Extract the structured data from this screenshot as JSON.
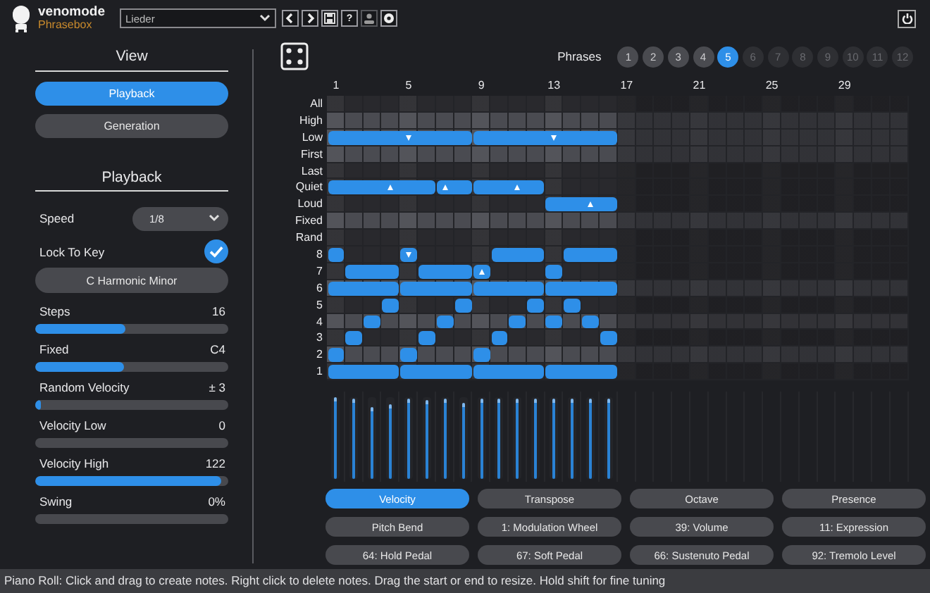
{
  "header": {
    "brand": "venomode",
    "product": "Phrasebox",
    "preset": "Lieder",
    "tools": [
      {
        "kind": "prev",
        "disabled": false
      },
      {
        "kind": "next",
        "disabled": false
      },
      {
        "kind": "save",
        "disabled": false
      },
      {
        "kind": "help",
        "label": "?",
        "disabled": false
      },
      {
        "kind": "user",
        "disabled": true
      },
      {
        "kind": "settings",
        "disabled": false
      }
    ]
  },
  "view": {
    "title": "View",
    "tabs": [
      {
        "label": "Playback",
        "selected": true
      },
      {
        "label": "Generation",
        "selected": false
      }
    ]
  },
  "playback": {
    "title": "Playback",
    "speed": {
      "label": "Speed",
      "value": "1/8"
    },
    "lock": {
      "label": "Lock To Key",
      "checked": true
    },
    "scale": "C Harmonic Minor",
    "sliders": [
      {
        "label": "Steps",
        "value": "16",
        "level": 0.47
      },
      {
        "label": "Fixed",
        "value": "C4",
        "level": 0.46
      },
      {
        "label": "Random Velocity",
        "value": "± 3",
        "level": 0.03
      },
      {
        "label": "Velocity Low",
        "value": "0",
        "level": 0
      },
      {
        "label": "Velocity High",
        "value": "122",
        "level": 0.96
      },
      {
        "label": "Swing",
        "value": "0%",
        "level": 0
      }
    ]
  },
  "phrases": {
    "label": "Phrases",
    "items": [
      {
        "label": "1",
        "selected": false,
        "filled": true
      },
      {
        "label": "2",
        "selected": false,
        "filled": true
      },
      {
        "label": "3",
        "selected": false,
        "filled": true
      },
      {
        "label": "4",
        "selected": false,
        "filled": true
      },
      {
        "label": "5",
        "selected": true,
        "filled": true
      },
      {
        "label": "6",
        "selected": false,
        "filled": false
      },
      {
        "label": "7",
        "selected": false,
        "filled": false
      },
      {
        "label": "8",
        "selected": false,
        "filled": false
      },
      {
        "label": "9",
        "selected": false,
        "filled": false
      },
      {
        "label": "10",
        "selected": false,
        "filled": false
      },
      {
        "label": "11",
        "selected": false,
        "filled": false
      },
      {
        "label": "12",
        "selected": false,
        "filled": false
      }
    ]
  },
  "grid": {
    "columns": [
      "1",
      "5",
      "9",
      "13",
      "17",
      "21",
      "25",
      "29"
    ],
    "rows": [
      {
        "label": "All",
        "shaded": false,
        "steps": [
          {
            "kind": "rest"
          },
          {
            "kind": "rest"
          },
          {
            "kind": "rest"
          },
          {
            "kind": "rest"
          },
          {
            "kind": "rest"
          },
          {
            "kind": "rest"
          },
          {
            "kind": "rest"
          },
          {
            "kind": "rest"
          },
          {
            "kind": "rest"
          },
          {
            "kind": "rest"
          },
          {
            "kind": "rest"
          },
          {
            "kind": "rest"
          },
          {
            "kind": "rest"
          },
          {
            "kind": "rest"
          },
          {
            "kind": "rest"
          },
          {
            "kind": "rest"
          }
        ]
      },
      {
        "label": "High",
        "shaded": true,
        "steps": [
          {
            "kind": "rest"
          },
          {
            "kind": "rest"
          },
          {
            "kind": "rest"
          },
          {
            "kind": "rest"
          },
          {
            "kind": "rest"
          },
          {
            "kind": "rest"
          },
          {
            "kind": "rest"
          },
          {
            "kind": "rest"
          },
          {
            "kind": "rest"
          },
          {
            "kind": "rest"
          },
          {
            "kind": "rest"
          },
          {
            "kind": "rest"
          },
          {
            "kind": "rest"
          },
          {
            "kind": "rest"
          },
          {
            "kind": "rest"
          },
          {
            "kind": "rest"
          }
        ]
      },
      {
        "label": "Low",
        "shaded": true,
        "steps": [
          {
            "kind": "note"
          },
          {
            "kind": "note",
            "tied": true
          },
          {
            "kind": "note",
            "tied": true
          },
          {
            "kind": "note",
            "tied": true
          },
          {
            "kind": "note-down",
            "tied": true
          },
          {
            "kind": "note",
            "tied": true
          },
          {
            "kind": "note",
            "tied": true
          },
          {
            "kind": "note",
            "tied": true
          },
          {
            "kind": "note",
            "tied": false
          },
          {
            "kind": "note",
            "tied": true
          },
          {
            "kind": "note",
            "tied": true
          },
          {
            "kind": "note",
            "tied": true
          },
          {
            "kind": "note-down",
            "tied": true
          },
          {
            "kind": "note",
            "tied": true
          },
          {
            "kind": "note",
            "tied": true
          },
          {
            "kind": "note",
            "tied": true
          }
        ]
      },
      {
        "label": "First",
        "shaded": true,
        "steps": [
          {
            "kind": "rest"
          },
          {
            "kind": "rest"
          },
          {
            "kind": "rest"
          },
          {
            "kind": "rest"
          },
          {
            "kind": "rest"
          },
          {
            "kind": "rest"
          },
          {
            "kind": "rest"
          },
          {
            "kind": "rest"
          },
          {
            "kind": "rest"
          },
          {
            "kind": "rest"
          },
          {
            "kind": "rest"
          },
          {
            "kind": "rest"
          },
          {
            "kind": "rest"
          },
          {
            "kind": "rest"
          },
          {
            "kind": "rest"
          },
          {
            "kind": "rest"
          }
        ]
      },
      {
        "label": "Last",
        "shaded": false,
        "steps": [
          {
            "kind": "rest"
          },
          {
            "kind": "rest"
          },
          {
            "kind": "rest"
          },
          {
            "kind": "rest"
          },
          {
            "kind": "rest"
          },
          {
            "kind": "rest"
          },
          {
            "kind": "rest"
          },
          {
            "kind": "rest"
          },
          {
            "kind": "rest"
          },
          {
            "kind": "rest"
          },
          {
            "kind": "rest"
          },
          {
            "kind": "rest"
          },
          {
            "kind": "rest"
          },
          {
            "kind": "rest"
          },
          {
            "kind": "rest"
          },
          {
            "kind": "rest"
          }
        ]
      },
      {
        "label": "Quiet",
        "shaded": false,
        "steps": [
          {
            "kind": "note"
          },
          {
            "kind": "note",
            "tied": true
          },
          {
            "kind": "note",
            "tied": true
          },
          {
            "kind": "note-up",
            "tied": true
          },
          {
            "kind": "note",
            "tied": true
          },
          {
            "kind": "note",
            "tied": true
          },
          {
            "kind": "note-up",
            "tied": false
          },
          {
            "kind": "note",
            "tied": true
          },
          {
            "kind": "note",
            "tied": false
          },
          {
            "kind": "note",
            "tied": true
          },
          {
            "kind": "note-up",
            "tied": true
          },
          {
            "kind": "note",
            "tied": true
          },
          {
            "kind": "rest"
          },
          {
            "kind": "rest"
          },
          {
            "kind": "rest"
          },
          {
            "kind": "rest"
          }
        ]
      },
      {
        "label": "Loud",
        "shaded": false,
        "steps": [
          {
            "kind": "rest"
          },
          {
            "kind": "rest"
          },
          {
            "kind": "rest"
          },
          {
            "kind": "rest"
          },
          {
            "kind": "rest"
          },
          {
            "kind": "rest"
          },
          {
            "kind": "rest"
          },
          {
            "kind": "rest"
          },
          {
            "kind": "rest"
          },
          {
            "kind": "rest"
          },
          {
            "kind": "rest"
          },
          {
            "kind": "rest"
          },
          {
            "kind": "note"
          },
          {
            "kind": "note",
            "tied": true
          },
          {
            "kind": "note-up",
            "tied": true
          },
          {
            "kind": "note",
            "tied": true
          }
        ]
      },
      {
        "label": "Fixed",
        "shaded": true,
        "steps": [
          {
            "kind": "rest"
          },
          {
            "kind": "rest"
          },
          {
            "kind": "rest"
          },
          {
            "kind": "rest"
          },
          {
            "kind": "rest"
          },
          {
            "kind": "rest"
          },
          {
            "kind": "rest"
          },
          {
            "kind": "rest"
          },
          {
            "kind": "rest"
          },
          {
            "kind": "rest"
          },
          {
            "kind": "rest"
          },
          {
            "kind": "rest"
          },
          {
            "kind": "rest"
          },
          {
            "kind": "rest"
          },
          {
            "kind": "rest"
          },
          {
            "kind": "rest"
          }
        ]
      },
      {
        "label": "Rand",
        "shaded": false,
        "steps": [
          {
            "kind": "rest"
          },
          {
            "kind": "rest"
          },
          {
            "kind": "rest"
          },
          {
            "kind": "rest"
          },
          {
            "kind": "rest"
          },
          {
            "kind": "rest"
          },
          {
            "kind": "rest"
          },
          {
            "kind": "rest"
          },
          {
            "kind": "rest"
          },
          {
            "kind": "rest"
          },
          {
            "kind": "rest"
          },
          {
            "kind": "rest"
          },
          {
            "kind": "rest"
          },
          {
            "kind": "rest"
          },
          {
            "kind": "rest"
          },
          {
            "kind": "rest"
          }
        ]
      },
      {
        "label": "8",
        "shaded": false,
        "steps": [
          {
            "kind": "note"
          },
          {
            "kind": "rest"
          },
          {
            "kind": "rest"
          },
          {
            "kind": "rest"
          },
          {
            "kind": "note-down"
          },
          {
            "kind": "rest"
          },
          {
            "kind": "rest"
          },
          {
            "kind": "rest"
          },
          {
            "kind": "rest"
          },
          {
            "kind": "note"
          },
          {
            "kind": "note",
            "tied": true
          },
          {
            "kind": "note",
            "tied": true
          },
          {
            "kind": "rest"
          },
          {
            "kind": "note"
          },
          {
            "kind": "note",
            "tied": true
          },
          {
            "kind": "note",
            "tied": true
          }
        ]
      },
      {
        "label": "7",
        "shaded": false,
        "steps": [
          {
            "kind": "rest"
          },
          {
            "kind": "note"
          },
          {
            "kind": "note",
            "tied": true
          },
          {
            "kind": "note",
            "tied": true
          },
          {
            "kind": "rest"
          },
          {
            "kind": "note"
          },
          {
            "kind": "note",
            "tied": true
          },
          {
            "kind": "note",
            "tied": true
          },
          {
            "kind": "note-up",
            "tied": false
          },
          {
            "kind": "rest"
          },
          {
            "kind": "rest"
          },
          {
            "kind": "rest"
          },
          {
            "kind": "note"
          },
          {
            "kind": "rest"
          },
          {
            "kind": "rest"
          },
          {
            "kind": "rest"
          }
        ]
      },
      {
        "label": "6",
        "shaded": true,
        "steps": [
          {
            "kind": "note"
          },
          {
            "kind": "note",
            "tied": true
          },
          {
            "kind": "note",
            "tied": true
          },
          {
            "kind": "note",
            "tied": true
          },
          {
            "kind": "note",
            "tied": false
          },
          {
            "kind": "note",
            "tied": true
          },
          {
            "kind": "note",
            "tied": true
          },
          {
            "kind": "note",
            "tied": true
          },
          {
            "kind": "note",
            "tied": false
          },
          {
            "kind": "note",
            "tied": true
          },
          {
            "kind": "note",
            "tied": true
          },
          {
            "kind": "note",
            "tied": true
          },
          {
            "kind": "note",
            "tied": false
          },
          {
            "kind": "note",
            "tied": true
          },
          {
            "kind": "note",
            "tied": true
          },
          {
            "kind": "note",
            "tied": true
          }
        ]
      },
      {
        "label": "5",
        "shaded": false,
        "steps": [
          {
            "kind": "rest"
          },
          {
            "kind": "rest"
          },
          {
            "kind": "rest"
          },
          {
            "kind": "note"
          },
          {
            "kind": "rest"
          },
          {
            "kind": "rest"
          },
          {
            "kind": "rest"
          },
          {
            "kind": "note"
          },
          {
            "kind": "rest"
          },
          {
            "kind": "rest"
          },
          {
            "kind": "rest"
          },
          {
            "kind": "note"
          },
          {
            "kind": "rest"
          },
          {
            "kind": "note"
          },
          {
            "kind": "rest"
          },
          {
            "kind": "rest"
          }
        ]
      },
      {
        "label": "4",
        "shaded": true,
        "steps": [
          {
            "kind": "rest"
          },
          {
            "kind": "rest"
          },
          {
            "kind": "note"
          },
          {
            "kind": "rest"
          },
          {
            "kind": "rest"
          },
          {
            "kind": "rest"
          },
          {
            "kind": "note"
          },
          {
            "kind": "rest"
          },
          {
            "kind": "rest"
          },
          {
            "kind": "rest"
          },
          {
            "kind": "note"
          },
          {
            "kind": "rest"
          },
          {
            "kind": "note"
          },
          {
            "kind": "rest"
          },
          {
            "kind": "note"
          },
          {
            "kind": "rest"
          }
        ]
      },
      {
        "label": "3",
        "shaded": false,
        "steps": [
          {
            "kind": "rest"
          },
          {
            "kind": "note"
          },
          {
            "kind": "rest"
          },
          {
            "kind": "rest"
          },
          {
            "kind": "rest"
          },
          {
            "kind": "note"
          },
          {
            "kind": "rest"
          },
          {
            "kind": "rest"
          },
          {
            "kind": "rest"
          },
          {
            "kind": "note"
          },
          {
            "kind": "rest"
          },
          {
            "kind": "rest"
          },
          {
            "kind": "rest"
          },
          {
            "kind": "rest"
          },
          {
            "kind": "rest"
          },
          {
            "kind": "note"
          }
        ]
      },
      {
        "label": "2",
        "shaded": true,
        "steps": [
          {
            "kind": "note"
          },
          {
            "kind": "rest"
          },
          {
            "kind": "rest"
          },
          {
            "kind": "rest"
          },
          {
            "kind": "note"
          },
          {
            "kind": "rest"
          },
          {
            "kind": "rest"
          },
          {
            "kind": "rest"
          },
          {
            "kind": "note"
          },
          {
            "kind": "rest"
          },
          {
            "kind": "rest"
          },
          {
            "kind": "rest"
          },
          {
            "kind": "rest"
          },
          {
            "kind": "rest"
          },
          {
            "kind": "rest"
          },
          {
            "kind": "rest"
          }
        ]
      },
      {
        "label": "1",
        "shaded": false,
        "steps": [
          {
            "kind": "note"
          },
          {
            "kind": "note",
            "tied": true
          },
          {
            "kind": "note",
            "tied": true
          },
          {
            "kind": "note",
            "tied": true
          },
          {
            "kind": "note",
            "tied": false
          },
          {
            "kind": "note",
            "tied": true
          },
          {
            "kind": "note",
            "tied": true
          },
          {
            "kind": "note",
            "tied": true
          },
          {
            "kind": "note",
            "tied": false
          },
          {
            "kind": "note",
            "tied": true
          },
          {
            "kind": "note",
            "tied": true
          },
          {
            "kind": "note",
            "tied": true
          },
          {
            "kind": "note",
            "tied": false
          },
          {
            "kind": "note",
            "tied": true
          },
          {
            "kind": "note",
            "tied": true
          },
          {
            "kind": "note",
            "tied": true
          }
        ]
      }
    ]
  },
  "velocity_lane": [
    {
      "level": 1
    },
    {
      "level": 0.98
    },
    {
      "level": 0.88
    },
    {
      "level": 0.91
    },
    {
      "level": 0.98
    },
    {
      "level": 0.97
    },
    {
      "level": 0.98
    },
    {
      "level": 0.93
    },
    {
      "level": 0.98
    },
    {
      "level": 0.98
    },
    {
      "level": 0.98
    },
    {
      "level": 0.98
    },
    {
      "level": 0.98
    },
    {
      "level": 0.98
    },
    {
      "level": 0.98
    },
    {
      "level": 0.98
    }
  ],
  "lanes": [
    {
      "label": "Velocity",
      "selected": true
    },
    {
      "label": "Transpose",
      "selected": false
    },
    {
      "label": "Octave",
      "selected": false
    },
    {
      "label": "Presence",
      "selected": false
    },
    {
      "label": "Pitch Bend",
      "selected": false
    },
    {
      "label": "1: Modulation Wheel",
      "selected": false
    },
    {
      "label": "39: Volume",
      "selected": false
    },
    {
      "label": "11: Expression",
      "selected": false
    },
    {
      "label": "64: Hold Pedal",
      "selected": false
    },
    {
      "label": "67: Soft Pedal",
      "selected": false
    },
    {
      "label": "66: Sustenuto Pedal",
      "selected": false
    },
    {
      "label": "92: Tremolo Level",
      "selected": false
    }
  ],
  "status_bar": "Piano Roll: Click and drag to create notes. Right click to delete notes. Drag the start or end to resize. Hold shift for fine tuning"
}
